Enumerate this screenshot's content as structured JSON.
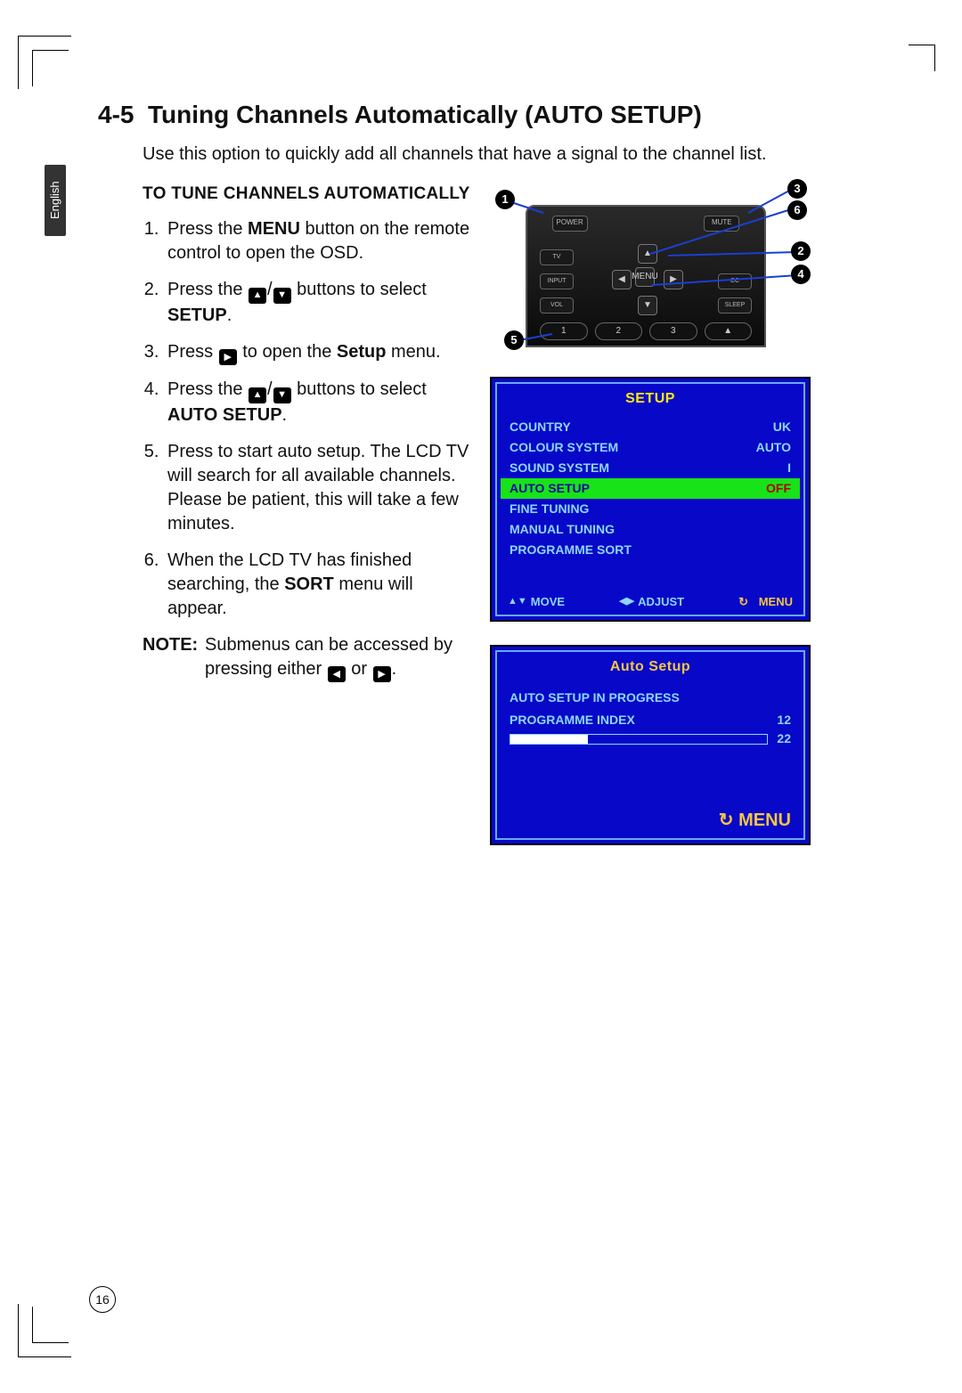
{
  "side_tab": "English",
  "section_number": "4-5",
  "section_title": "Tuning Channels Automatically (AUTO SETUP)",
  "intro": "Use this option to quickly add all channels that have a signal to the channel list.",
  "subhead": "TO TUNE CHANNELS AUTOMATICALLY",
  "steps": {
    "s1a": "Press the ",
    "s1b": "MENU",
    "s1c": " button on the remote control to open the OSD.",
    "s2a": "Press the ",
    "s2b": " buttons to select ",
    "s2c": "SETUP",
    "s2d": ".",
    "s3a": "Press ",
    "s3b": " to open the ",
    "s3c": "Setup",
    "s3d": " menu.",
    "s4a": "Press the ",
    "s4b": " buttons to select ",
    "s4c": "AUTO SETUP",
    "s4d": ".",
    "s5": "Press to start auto setup. The LCD TV will search for all available channels. Please be patient, this will take a few minutes.",
    "s6a": "When the LCD TV has finished searching, the ",
    "s6b": "SORT",
    "s6c": " menu will appear."
  },
  "note_label": "NOTE:",
  "note_a": "Submenus can be accessed by pressing either ",
  "note_b": " or ",
  "note_c": ".",
  "remote": {
    "power": "POWER",
    "mute": "MUTE",
    "tv": "TV",
    "input": "INPUT",
    "vol": "VOL",
    "cc": "CC",
    "sleep": "SLEEP",
    "menu": "MENU",
    "n1": "1",
    "n2": "2",
    "n3": "3",
    "c1": "1",
    "c2": "2",
    "c3": "3",
    "c4": "4",
    "c5": "5",
    "c6": "6"
  },
  "osd1": {
    "title": "SETUP",
    "rows": [
      {
        "label": "COUNTRY",
        "value": "UK"
      },
      {
        "label": "COLOUR SYSTEM",
        "value": "AUTO"
      },
      {
        "label": "SOUND SYSTEM",
        "value": "I"
      },
      {
        "label": "AUTO SETUP",
        "value": "OFF"
      },
      {
        "label": "FINE TUNING",
        "value": ""
      },
      {
        "label": "MANUAL TUNING",
        "value": ""
      },
      {
        "label": "PROGRAMME SORT",
        "value": ""
      }
    ],
    "footer_move": "MOVE",
    "footer_adjust": "ADJUST",
    "footer_menu": "MENU"
  },
  "osd2": {
    "title": "Auto Setup",
    "line1": "AUTO SETUP IN PROGRESS",
    "line2_label": "PROGRAMME INDEX",
    "line2_val": "12",
    "line3_val": "22",
    "footer_menu": "MENU"
  },
  "page_number": "16"
}
